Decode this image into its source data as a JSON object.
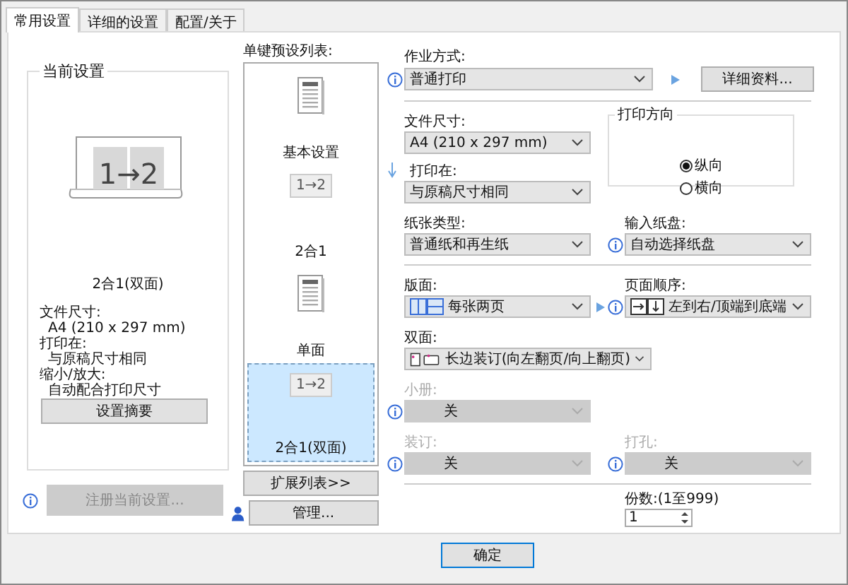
{
  "tabs": [
    {
      "label": "常用设置",
      "selected": true
    },
    {
      "label": "详细的设置",
      "selected": false
    },
    {
      "label": "配置/关于",
      "selected": false
    }
  ],
  "current_settings": {
    "title": "当前设置",
    "preview_text": "1→2",
    "caption": "2合1(双面)",
    "details": [
      {
        "label": "文件尺寸:",
        "value": "A4 (210 x 297 mm)"
      },
      {
        "label": "打印在:",
        "value": "与原稿尺寸相同"
      },
      {
        "label": "缩小/放大:",
        "value": "自动配合打印尺寸"
      }
    ],
    "summary_button": "设置摘要",
    "register_button": {
      "label": "注册当前设置...",
      "disabled": true
    }
  },
  "presets": {
    "title": "单键预设列表:",
    "items": [
      {
        "label": "基本设置",
        "kind": "document",
        "selected": false
      },
      {
        "label": "2合1",
        "kind": "two_in_one",
        "icon_text": "1→2",
        "selected": false
      },
      {
        "label": "单面",
        "kind": "document",
        "selected": false
      },
      {
        "label": "2合1(双面)",
        "kind": "two_in_one",
        "icon_text": "1→2",
        "selected": true
      }
    ],
    "expand_button": "扩展列表>>",
    "manage_button": "管理..."
  },
  "job": {
    "label": "作业方式:",
    "value": "普通打印",
    "details_button": "详细资料..."
  },
  "paper_size": {
    "label": "文件尺寸:",
    "value": "A4 (210 x 297 mm)"
  },
  "print_on": {
    "label": "打印在:",
    "value": "与原稿尺寸相同"
  },
  "orientation": {
    "title": "打印方向",
    "options": [
      {
        "label": "纵向",
        "selected": true
      },
      {
        "label": "横向",
        "selected": false
      }
    ]
  },
  "paper_type": {
    "label": "纸张类型:",
    "value": "普通纸和再生纸"
  },
  "input_tray": {
    "label": "输入纸盘:",
    "value": "自动选择纸盘"
  },
  "layout": {
    "label": "版面:",
    "value": "每张两页"
  },
  "page_order": {
    "label": "页面顺序:",
    "value": "左到右/顶端到底端"
  },
  "duplex": {
    "label": "双面:",
    "value": "长边装订(向左翻页/向上翻页)"
  },
  "booklet": {
    "label": "小册:",
    "value": "关",
    "disabled": true
  },
  "binding": {
    "label": "装订:",
    "value": "关",
    "disabled": true
  },
  "punch": {
    "label": "打孔:",
    "value": "关",
    "disabled": true
  },
  "copies": {
    "label": "份数:(1至999)",
    "value": "1"
  },
  "ok_button": "确定"
}
